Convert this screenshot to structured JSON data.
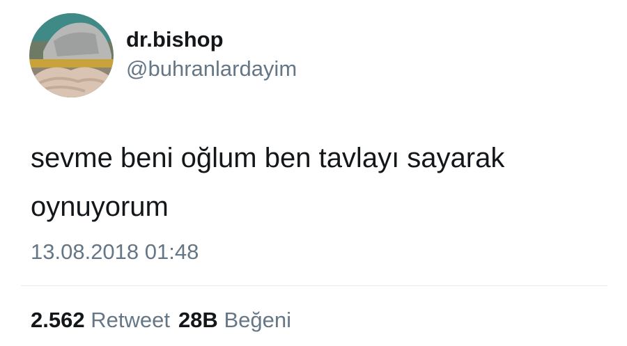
{
  "author": {
    "display_name": "dr.bishop",
    "handle": "@buhranlardayim",
    "avatar_icon": "profile-photo"
  },
  "tweet": {
    "text": "sevme beni oğlum ben tavlayı sayarak oynuyorum",
    "timestamp": "13.08.2018 01:48"
  },
  "stats": {
    "retweets_count": "2.562",
    "retweets_label": "Retweet",
    "likes_count": "28B",
    "likes_label": "Beğeni"
  },
  "colors": {
    "text_primary": "#14171a",
    "text_secondary": "#657786",
    "divider": "#e6ecf0",
    "background": "#ffffff"
  }
}
